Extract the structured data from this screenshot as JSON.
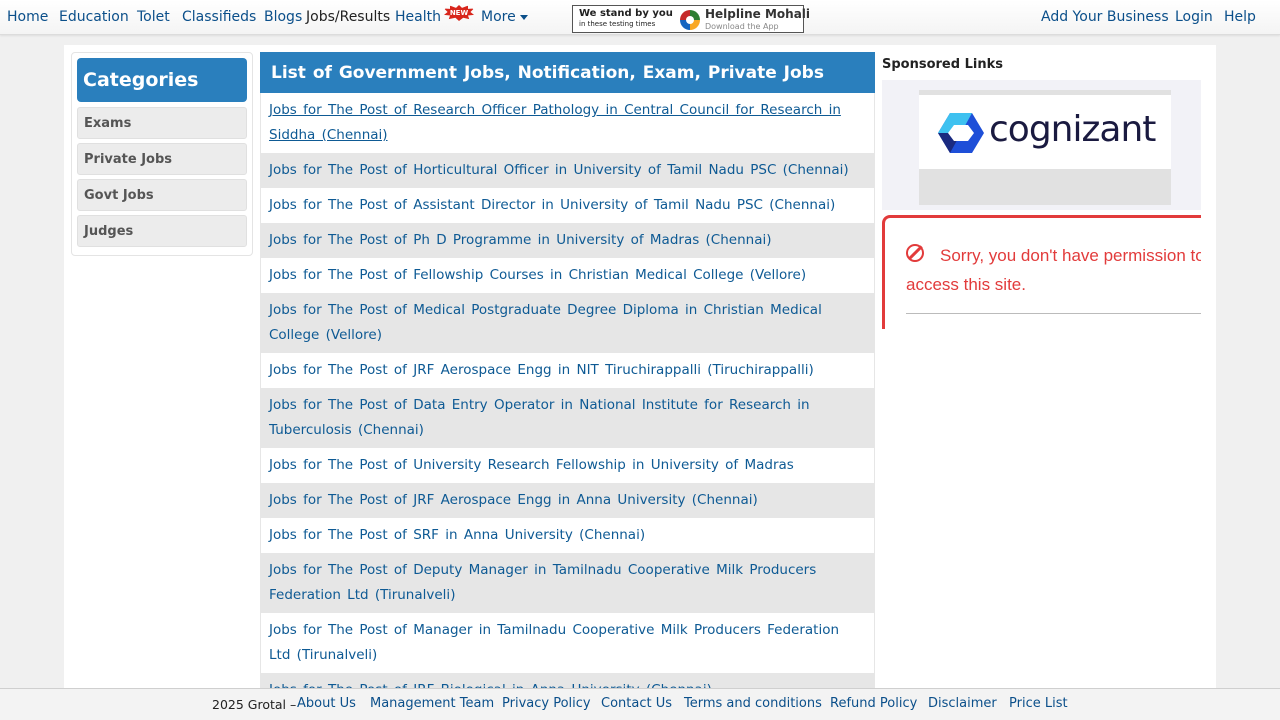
{
  "nav": {
    "left": [
      "Home",
      "Education",
      "Tolet",
      "Classifieds",
      "Blogs",
      "Jobs/Results",
      "Health",
      "More"
    ],
    "new_badge": "NEW",
    "right": [
      "Add Your Business",
      "Login",
      "Help"
    ],
    "banner": {
      "line1": "We stand by you",
      "line2": "in these testing times",
      "title": "Helpline Mohali",
      "subtitle": "Download the App"
    }
  },
  "categories": {
    "title": "Categories",
    "items": [
      "Exams",
      "Private Jobs",
      "Govt Jobs",
      "Judges"
    ]
  },
  "jobs": {
    "header": "List of Government Jobs, Notification, Exam, Private Jobs",
    "items": [
      "Jobs for The Post of Research Officer Pathology in Central Council for Research in Siddha (Chennai)",
      "Jobs for The Post of Horticultural Officer in University of Tamil Nadu PSC (Chennai)",
      "Jobs for The Post of Assistant Director in University of Tamil Nadu PSC (Chennai)",
      "Jobs for The Post of Ph D Programme in University of Madras (Chennai)",
      "Jobs for The Post of Fellowship Courses in Christian Medical College (Vellore)",
      "Jobs for The Post of Medical Postgraduate Degree Diploma in Christian Medical College (Vellore)",
      "Jobs for The Post of JRF Aerospace Engg in NIT Tiruchirappalli (Tiruchirappalli)",
      "Jobs for The Post of Data Entry Operator in National Institute for Research in Tuberculosis (Chennai)",
      "Jobs for The Post of University Research Fellowship in University of Madras (Chennai)",
      "Jobs for The Post of JRF Aerospace Engg in Anna University (Chennai)",
      "Jobs for The Post of SRF in Anna University (Chennai)",
      "Jobs for The Post of Deputy Manager in Tamilnadu Cooperative Milk Producers Federation Ltd (Tirunalveli)",
      "Jobs for The Post of Manager in Tamilnadu Cooperative Milk Producers Federation Ltd (Tirunalveli)",
      "Jobs for The Post of JRF Biological in Anna University (Chennai)"
    ]
  },
  "sponsored": {
    "title": "Sponsored Links",
    "ad_brand": "cognizant",
    "error_message": "Sorry, you don't have permission to access this site."
  },
  "footer": {
    "copyright": "2025 Grotal –",
    "links": [
      "About Us",
      "Management Team",
      "Privacy Policy",
      "Contact Us",
      "Terms and conditions",
      "Refund Policy",
      "Disclaimer",
      "Price List"
    ]
  },
  "colors": {
    "accent": "#2a7fbd",
    "link": "#0e5a94",
    "error": "#e23b3b"
  }
}
